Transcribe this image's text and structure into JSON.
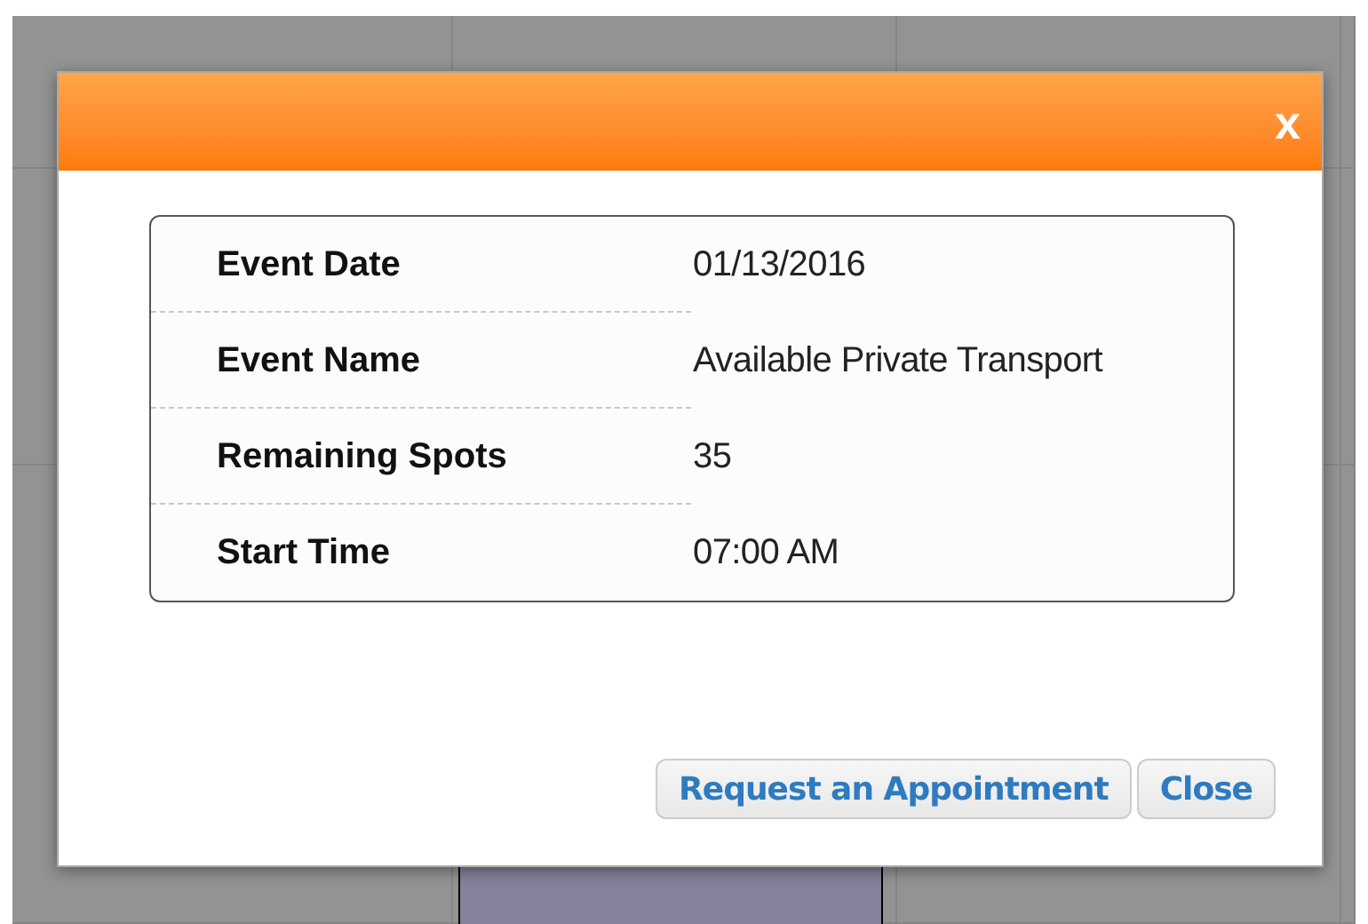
{
  "dialog": {
    "close_label": "x",
    "details": [
      {
        "label": "Event Date",
        "value": "01/13/2016"
      },
      {
        "label": "Event Name",
        "value": "Available Private Transport"
      },
      {
        "label": "Remaining Spots",
        "value": "35"
      },
      {
        "label": "Start Time",
        "value": "07:00 AM"
      }
    ],
    "buttons": [
      "Request an Appointment",
      "Close"
    ]
  }
}
